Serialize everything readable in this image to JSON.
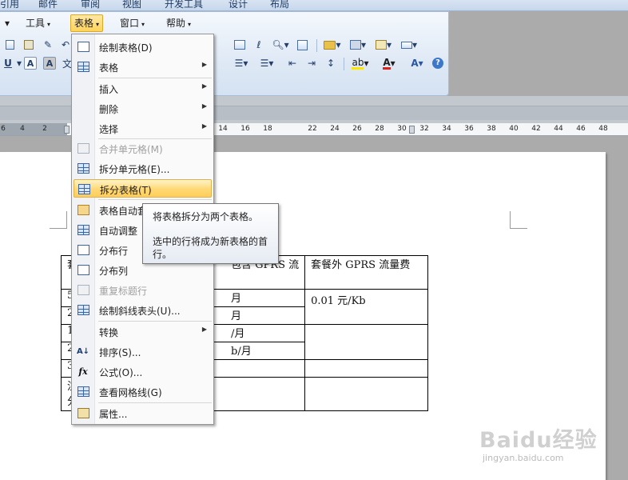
{
  "ribbon_tabs": [
    "引用",
    "邮件",
    "审阅",
    "视图",
    "开发工具",
    "设计",
    "布局"
  ],
  "menubar": {
    "items": [
      "工具",
      "表格",
      "窗口",
      "帮助"
    ],
    "left_arrow": "▾"
  },
  "toolbar_row2": {
    "font_a_box": "A",
    "font_a_shaded": "A"
  },
  "ruler": {
    "ticks": [
      "6",
      "4",
      "2",
      "14",
      "16",
      "18",
      "22",
      "24",
      "26",
      "28",
      "30",
      "32",
      "34",
      "36",
      "38",
      "40",
      "42",
      "44",
      "46",
      "48"
    ]
  },
  "table_menu": {
    "items": [
      {
        "label": "绘制表格(D)",
        "icon": "pencil-icon",
        "disabled": false,
        "submenu": false
      },
      {
        "label": "表格",
        "icon": "table-icon",
        "disabled": false,
        "submenu": true
      },
      {
        "label": "插入",
        "icon": "",
        "disabled": false,
        "submenu": true
      },
      {
        "label": "删除",
        "icon": "",
        "disabled": false,
        "submenu": true
      },
      {
        "label": "选择",
        "icon": "",
        "disabled": false,
        "submenu": true
      },
      {
        "label": "合并单元格(M)",
        "icon": "merge-cells-icon",
        "disabled": true,
        "submenu": false
      },
      {
        "label": "拆分单元格(E)...",
        "icon": "split-cells-icon",
        "disabled": false,
        "submenu": false
      },
      {
        "label": "拆分表格(T)",
        "icon": "split-table-icon",
        "disabled": false,
        "submenu": false
      },
      {
        "label": "表格自动套",
        "icon": "table-autoformat-icon",
        "disabled": false,
        "submenu": false
      },
      {
        "label": "自动调整",
        "icon": "autofit-icon",
        "disabled": false,
        "submenu": false
      },
      {
        "label": "分布行",
        "icon": "distribute-rows-icon",
        "disabled": false,
        "submenu": false
      },
      {
        "label": "分布列",
        "icon": "distribute-columns-icon",
        "disabled": false,
        "submenu": false
      },
      {
        "label": "重复标题行",
        "icon": "repeat-header-icon",
        "disabled": true,
        "submenu": false
      },
      {
        "label": "绘制斜线表头(U)...",
        "icon": "diagonal-header-icon",
        "disabled": false,
        "submenu": false
      },
      {
        "label": "转换",
        "icon": "",
        "disabled": false,
        "submenu": true
      },
      {
        "label": "排序(S)...",
        "icon": "sort-icon",
        "disabled": false,
        "submenu": false
      },
      {
        "label": "公式(O)...",
        "icon": "formula-icon",
        "disabled": false,
        "submenu": false
      },
      {
        "label": "查看网格线(G)",
        "icon": "gridlines-icon",
        "disabled": false,
        "submenu": false
      },
      {
        "label": "属性...",
        "icon": "properties-icon",
        "disabled": false,
        "submenu": false
      }
    ],
    "highlighted": "拆分表格(T)"
  },
  "icon_glyphs": {
    "sort": "A↓",
    "formula": "fx"
  },
  "tooltip": {
    "title": "将表格拆分为两个表格。",
    "body": "选中的行将成为新表格的首行。"
  },
  "doc_table": {
    "header_col2": "包含 GPRS 流",
    "header_col3": "套餐外 GPRS 流量费",
    "col1_fragments": [
      "套",
      "5",
      "2",
      "1",
      "2",
      "3",
      "注",
      "分"
    ],
    "col2_fragments": [
      "月",
      "月",
      "/月",
      "b/月",
      "",
      ""
    ],
    "col3_value": "0.01 元/Kb"
  },
  "watermark": {
    "brand": "Baidu经验",
    "url": "jingyan.baidu.com"
  },
  "colors": {
    "menu_highlight": "#ffd874",
    "ribbon_bg": "#dfe9f5",
    "workspace": "#ababab"
  }
}
